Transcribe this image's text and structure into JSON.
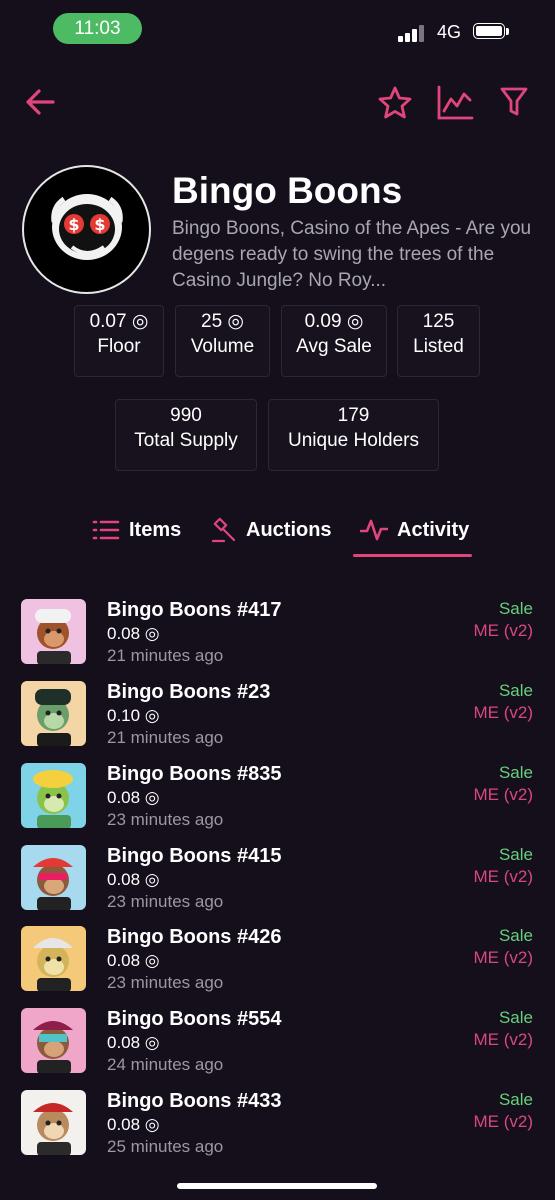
{
  "status_bar": {
    "time": "11:03",
    "network": "4G"
  },
  "nav": {
    "back_icon": "arrow-left-icon",
    "favorite_icon": "star-icon",
    "chart_icon": "chart-icon",
    "filter_icon": "filter-icon"
  },
  "collection": {
    "title": "Bingo Boons",
    "description": "Bingo Boons, Casino of the Apes - Are you degens ready to swing the trees of the Casino Jungle? No Roy..."
  },
  "stats": {
    "floor": {
      "value": "0.07 ◎",
      "label": "Floor"
    },
    "volume": {
      "value": "25 ◎",
      "label": "Volume"
    },
    "avg_sale": {
      "value": "0.09 ◎",
      "label": "Avg Sale"
    },
    "listed": {
      "value": "125",
      "label": "Listed"
    },
    "total_supply": {
      "value": "990",
      "label": "Total Supply"
    },
    "unique_holders": {
      "value": "179",
      "label": "Unique Holders"
    }
  },
  "tabs": [
    {
      "label": "Items",
      "icon": "list-icon"
    },
    {
      "label": "Auctions",
      "icon": "gavel-icon"
    },
    {
      "label": "Activity",
      "icon": "activity-icon",
      "active": true
    }
  ],
  "activity": [
    {
      "name": "Bingo Boons #417",
      "price": "0.08 ◎",
      "time": "21 minutes ago",
      "type": "Sale",
      "market": "ME (v2)"
    },
    {
      "name": "Bingo Boons #23",
      "price": "0.10 ◎",
      "time": "21 minutes ago",
      "type": "Sale",
      "market": "ME (v2)"
    },
    {
      "name": "Bingo Boons #835",
      "price": "0.08 ◎",
      "time": "23 minutes ago",
      "type": "Sale",
      "market": "ME (v2)"
    },
    {
      "name": "Bingo Boons #415",
      "price": "0.08 ◎",
      "time": "23 minutes ago",
      "type": "Sale",
      "market": "ME (v2)"
    },
    {
      "name": "Bingo Boons #426",
      "price": "0.08 ◎",
      "time": "23 minutes ago",
      "type": "Sale",
      "market": "ME (v2)"
    },
    {
      "name": "Bingo Boons #554",
      "price": "0.08 ◎",
      "time": "24 minutes ago",
      "type": "Sale",
      "market": "ME (v2)"
    },
    {
      "name": "Bingo Boons #433",
      "price": "0.08 ◎",
      "time": "25 minutes ago",
      "type": "Sale",
      "market": "ME (v2)"
    }
  ],
  "colors": {
    "accent": "#e0457b",
    "sale": "#67d07c",
    "market": "#d94781",
    "background": "#140f1b"
  }
}
